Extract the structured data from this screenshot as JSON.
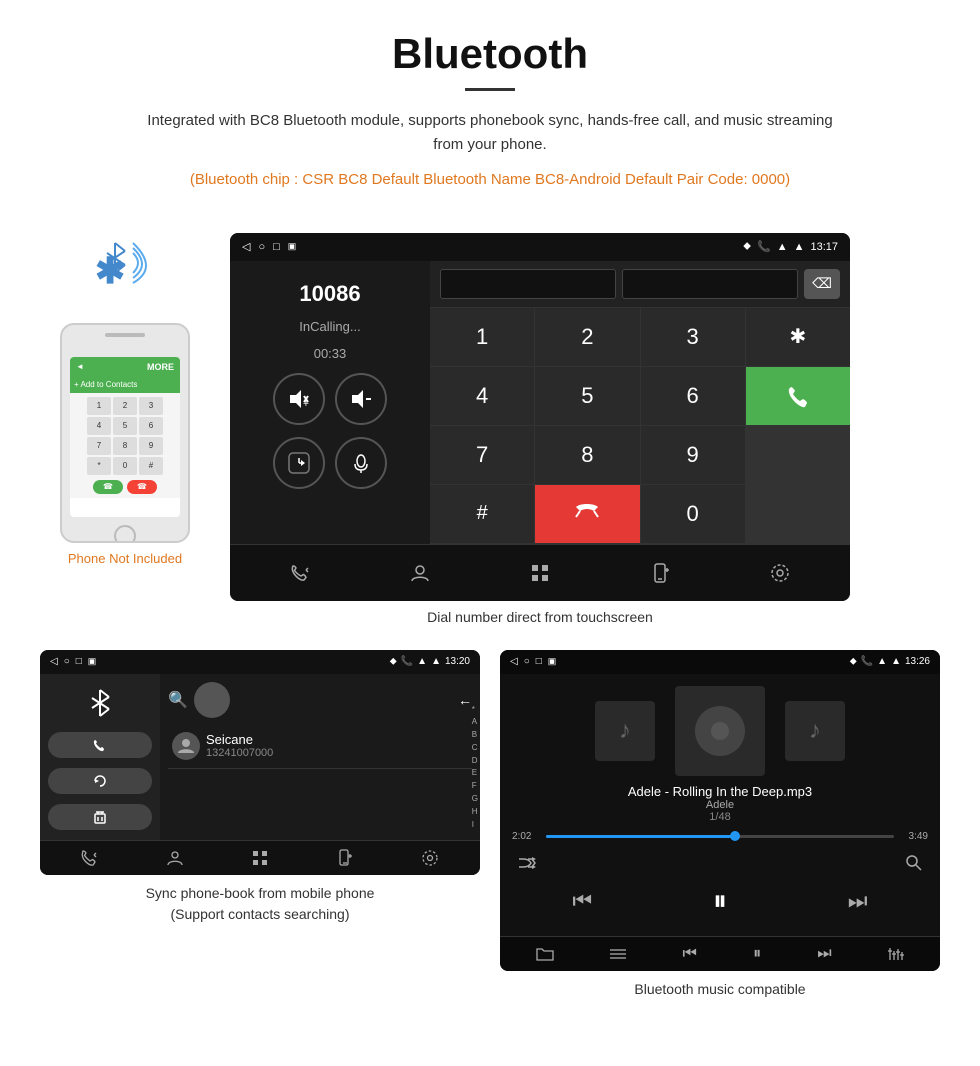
{
  "page": {
    "title": "Bluetooth",
    "divider": true,
    "description": "Integrated with BC8 Bluetooth module, supports phonebook sync, hands-free call, and music streaming from your phone.",
    "orange_info": "(Bluetooth chip : CSR BC8    Default Bluetooth Name BC8-Android    Default Pair Code: 0000)"
  },
  "phone_section": {
    "not_included": "Phone Not Included"
  },
  "dial_screen": {
    "number": "10086",
    "status": "InCalling...",
    "timer": "00:33",
    "keys": [
      "1",
      "2",
      "3",
      "*",
      "",
      "4",
      "5",
      "6",
      "0",
      "",
      "7",
      "8",
      "9",
      "#",
      ""
    ],
    "caption": "Dial number direct from touchscreen",
    "time": "13:17"
  },
  "contacts_screen": {
    "time": "13:20",
    "contact_name": "Seicane",
    "contact_number": "13241007000",
    "alphabet": [
      "*",
      "A",
      "B",
      "C",
      "D",
      "E",
      "F",
      "G",
      "H",
      "I"
    ],
    "caption_line1": "Sync phone-book from mobile phone",
    "caption_line2": "(Support contacts searching)"
  },
  "music_screen": {
    "time": "13:26",
    "song_title": "Adele - Rolling In the Deep.mp3",
    "artist": "Adele",
    "track_info": "1/48",
    "time_current": "2:02",
    "time_total": "3:49",
    "progress_percent": 55,
    "caption": "Bluetooth music compatible"
  },
  "icons": {
    "back": "◁",
    "home": "○",
    "recents": "□",
    "location": "⬥",
    "phone": "📞",
    "signal": "▲",
    "wifi": "▲",
    "bluetooth_sym": "✴",
    "search": "🔍",
    "contacts": "👤",
    "grid": "⊞",
    "device": "📱",
    "settings": "⚙",
    "call_transfer": "↗",
    "shuffle": "⇄",
    "prev": "⏮",
    "play_pause": "⏸",
    "next": "⏭",
    "equalizer": "≡",
    "folder": "📁",
    "list": "☰",
    "trash": "🗑",
    "refresh": "↺",
    "add": "+",
    "backspace": "⌫",
    "vol_up": "◄+",
    "vol_down": "◄-",
    "transfer": "⇥",
    "mic": "🎤",
    "mute_call": "🔇",
    "end_call": "📵",
    "music_note": "♪"
  }
}
